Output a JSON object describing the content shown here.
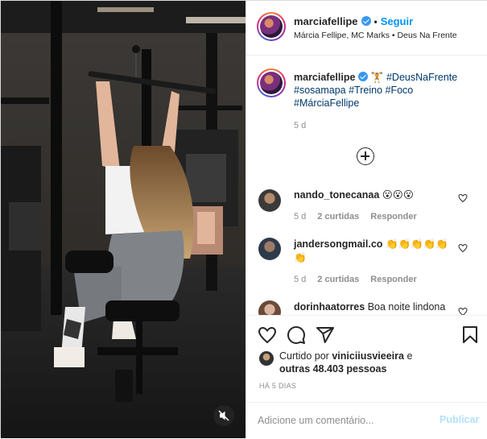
{
  "header": {
    "username": "marciafellipe",
    "follow_label": "Seguir",
    "separator": "•",
    "audio_line": "Márcia Fellipe, MC Marks • Deus Na Frente"
  },
  "caption": {
    "username": "marciafellipe",
    "emoji": "🏋",
    "hashtags": [
      "#DeusNaFrente",
      "#sosamapa",
      "#Treino",
      "#Foco",
      "#MárciaFellipe"
    ],
    "time": "5 d"
  },
  "comments": [
    {
      "username": "nando_tonecanaa",
      "text": "😮😮😮",
      "time": "5 d",
      "likes": "2 curtidas",
      "reply": "Responder"
    },
    {
      "username": "jandersongmail.co",
      "text": "👏👏👏👏👏👏",
      "time": "5 d",
      "likes": "2 curtidas",
      "reply": "Responder"
    },
    {
      "username": "dorinhaatorres",
      "text": "Boa noite lindona",
      "time": "",
      "likes": "",
      "reply": ""
    }
  ],
  "likes": {
    "prefix": "Curtido por",
    "user": "viniciiusvieeira",
    "connector": "e",
    "others": "outras 48.403 pessoas"
  },
  "posted_ago": "HÁ 5 DIAS",
  "add_comment": {
    "placeholder": "Adicione um comentário...",
    "publish_label": "Publicar"
  },
  "colors": {
    "accent": "#0095f6",
    "hashtag": "#00376b",
    "muted": "#8e8e8e",
    "publish_disabled": "#b2dffc"
  },
  "icons": [
    "heart-icon",
    "comment-icon",
    "share-icon",
    "bookmark-icon",
    "add-circle-icon",
    "mute-icon",
    "verified-icon"
  ]
}
